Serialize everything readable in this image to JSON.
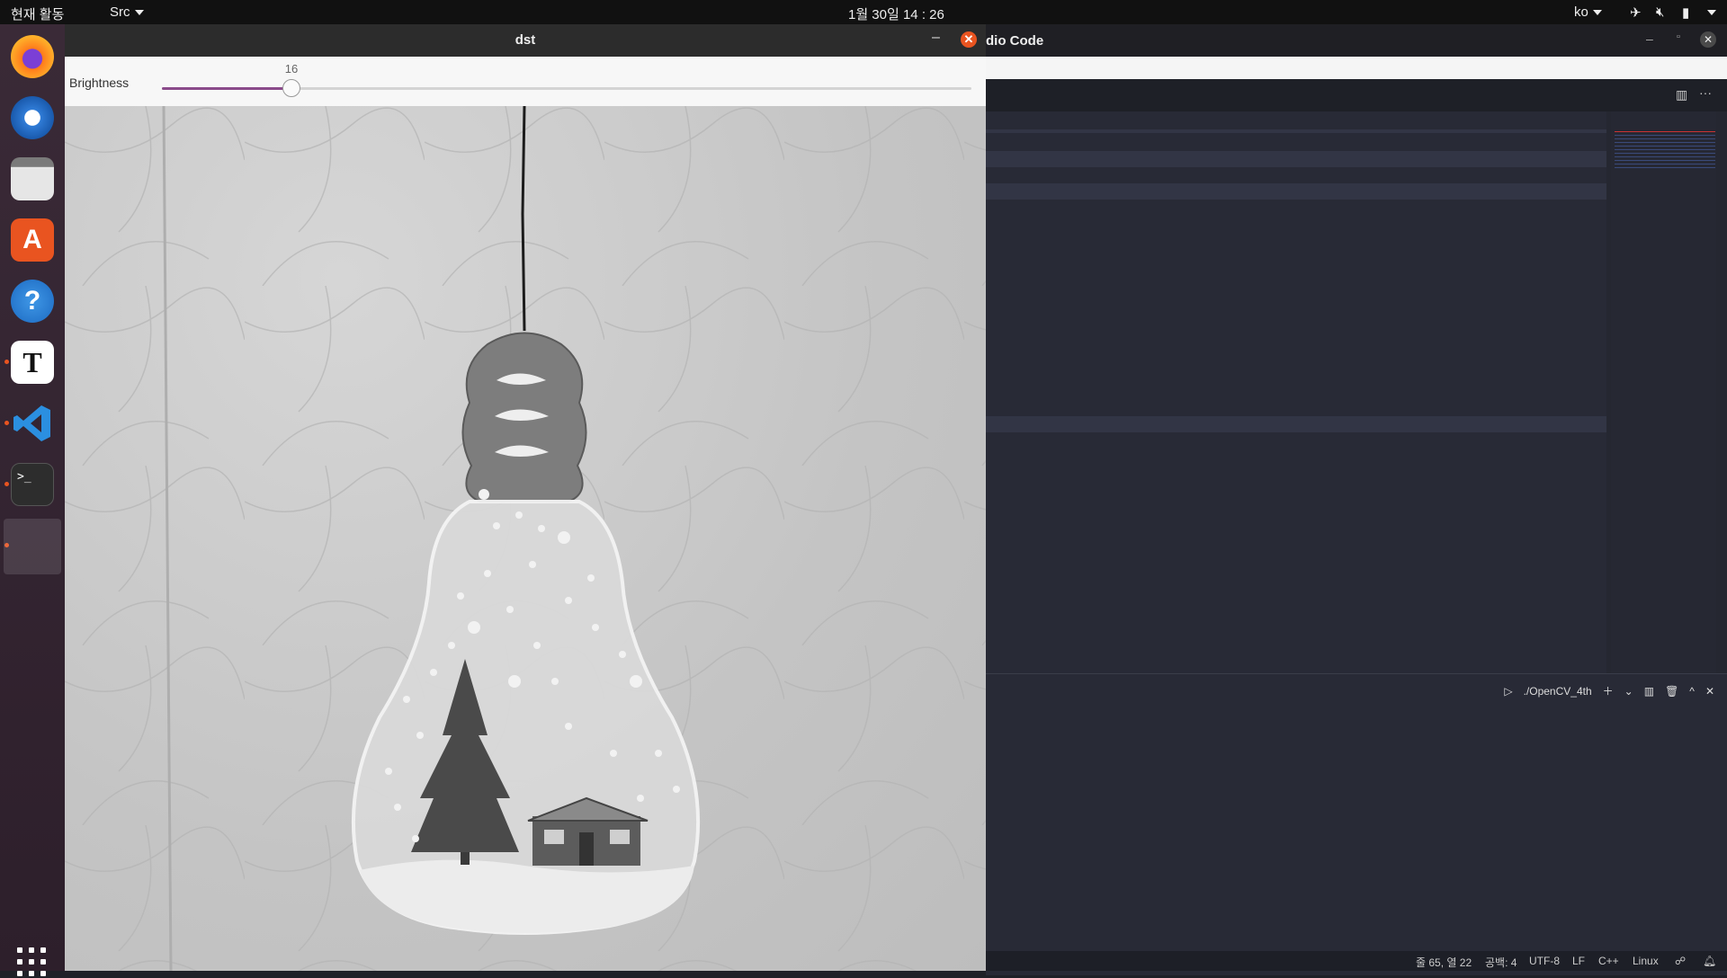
{
  "topbar": {
    "activities": "현재 활동",
    "app_menu": "Src",
    "clock": "1월 30일  14 : 26",
    "lang": "ko"
  },
  "dock": {
    "icons": [
      "firefox-icon",
      "thunderbird-icon",
      "files-icon",
      "software-icon",
      "help-icon",
      "typora-icon",
      "vscode-icon",
      "terminal-icon",
      "opencv-window-icon"
    ],
    "accent": "#e95420"
  },
  "dst_window": {
    "title": "dst",
    "min_glyph": "–",
    "close_glyph": "✕",
    "trackbar": {
      "label": "Brightness",
      "value": "16",
      "level_fraction": 0.16
    }
  },
  "vscode": {
    "title": "dio Code",
    "terminal_name": "./OpenCV_4th",
    "status": {
      "position": "줄 65, 열 22",
      "spaces": "공백: 4",
      "encoding": "UTF-8",
      "eol": "LF",
      "language": "C++",
      "platform": "Linux"
    }
  }
}
